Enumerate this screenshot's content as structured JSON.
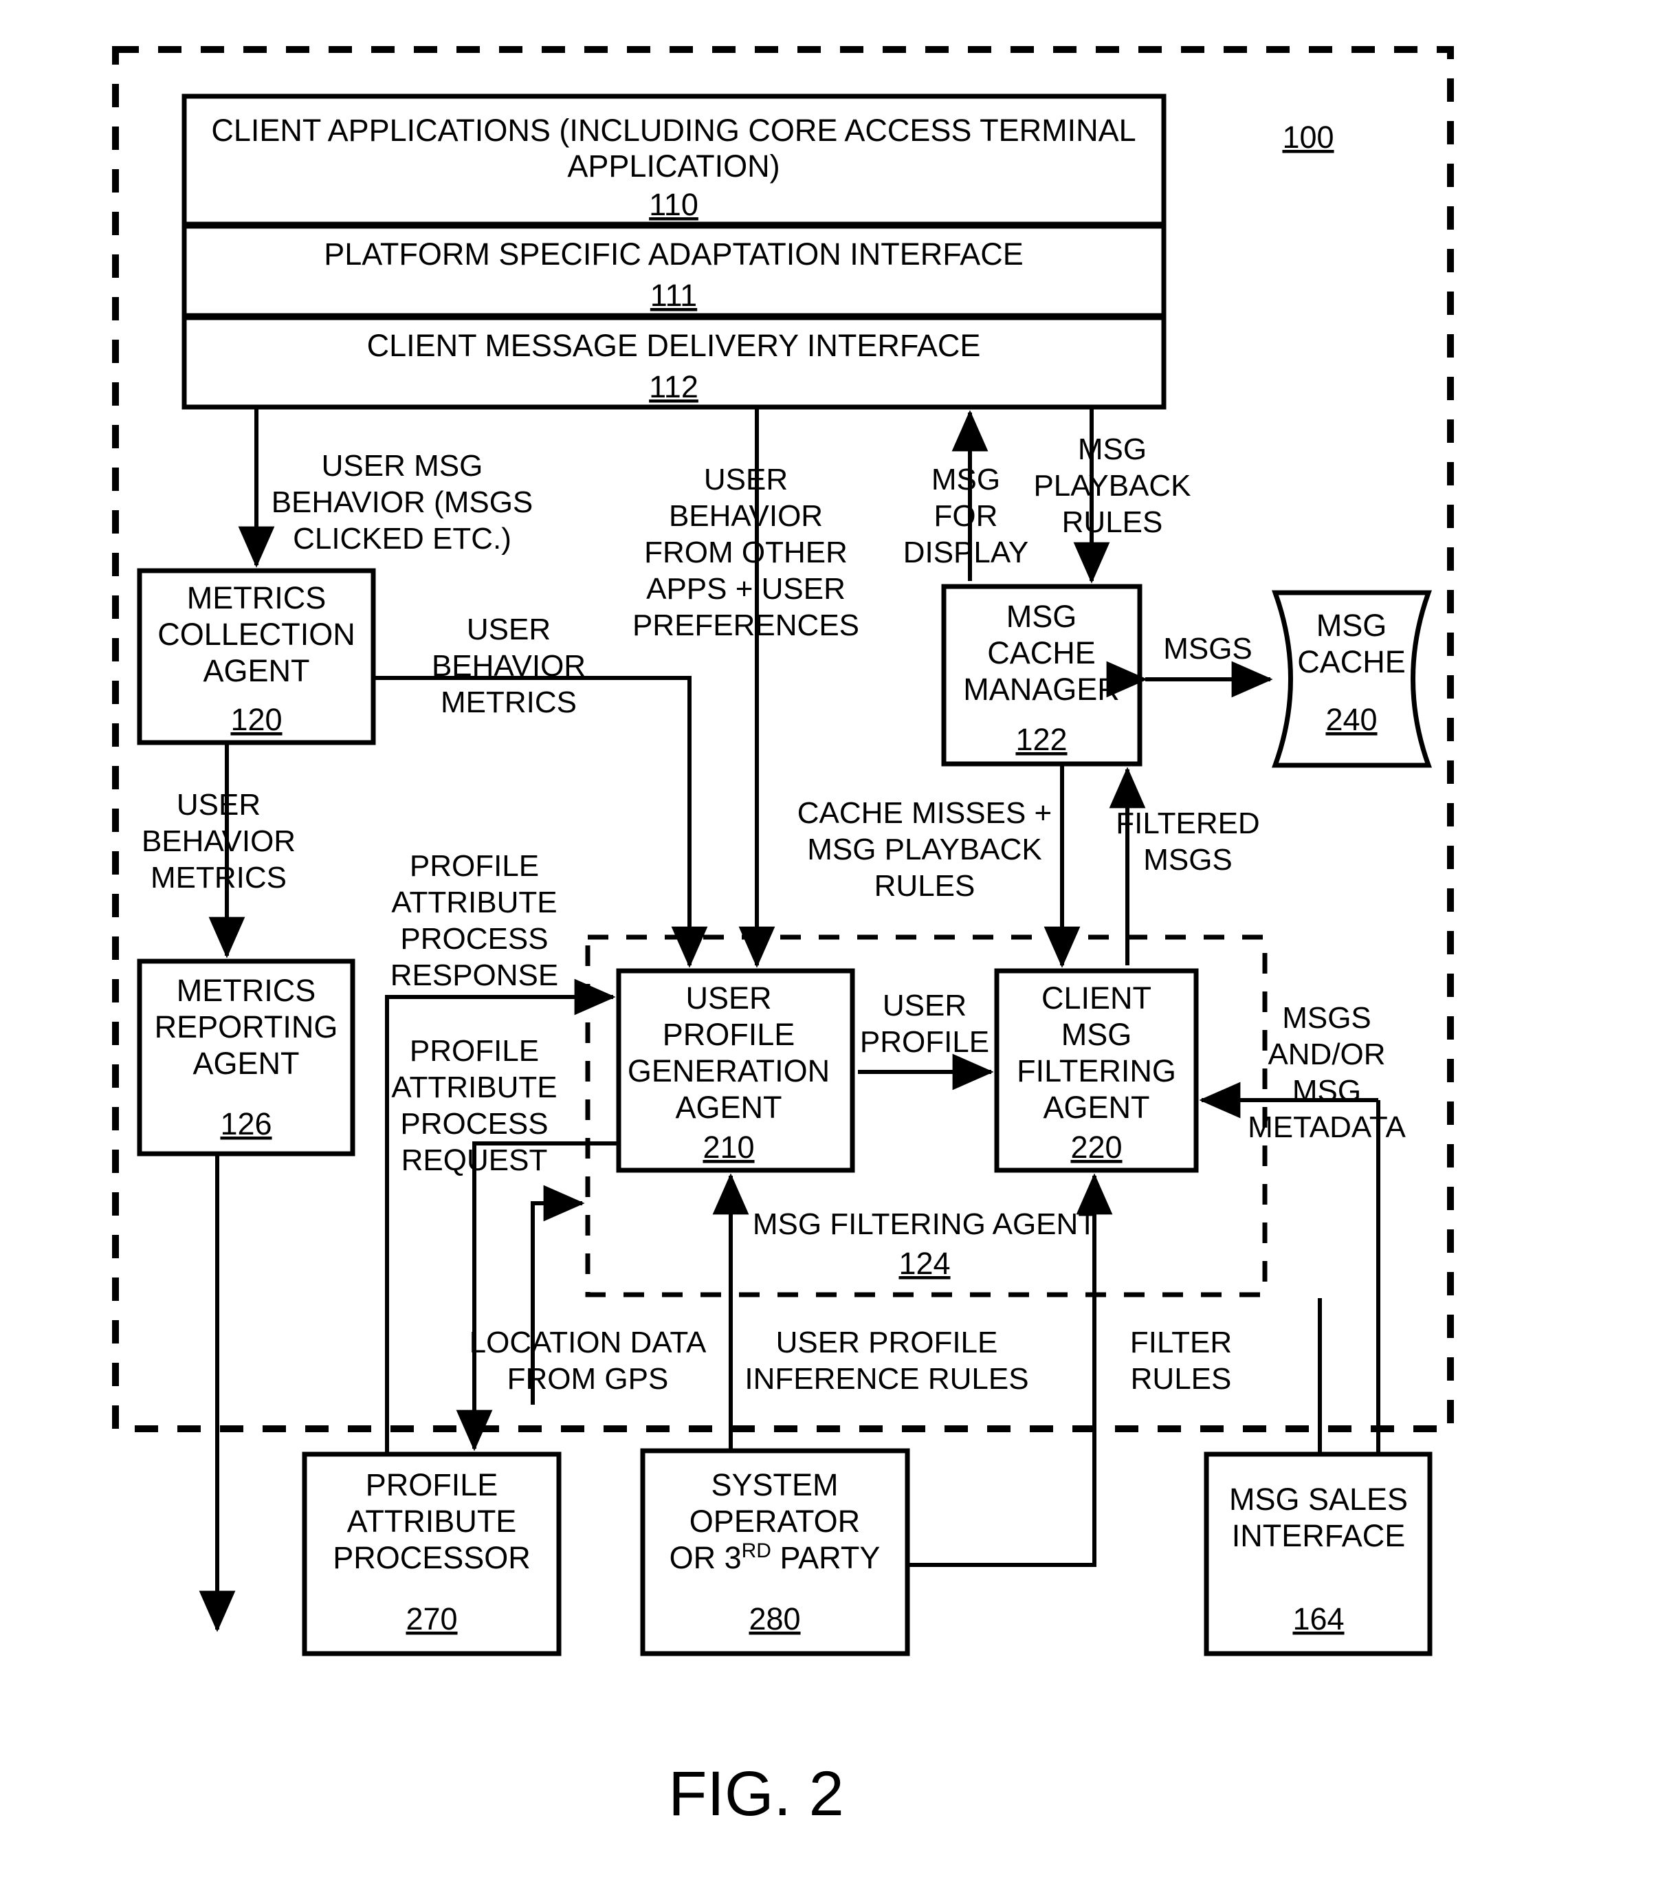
{
  "figure": {
    "caption": "FIG. 2",
    "system_ref": "100"
  },
  "layered_stack": [
    {
      "name": "client-applications",
      "label_line1": "CLIENT APPLICATIONS (INCLUDING CORE ACCESS TERMINAL",
      "label_line2": "APPLICATION)",
      "ref": "110"
    },
    {
      "name": "platform-adaptation-interface",
      "label_line1": "PLATFORM SPECIFIC ADAPTATION INTERFACE",
      "label_line2": "",
      "ref": "111"
    },
    {
      "name": "client-message-delivery-interface",
      "label_line1": "CLIENT MESSAGE DELIVERY INTERFACE",
      "label_line2": "",
      "ref": "112"
    }
  ],
  "boxes": {
    "metrics_collection_agent": {
      "lines": [
        "METRICS",
        "COLLECTION",
        "AGENT"
      ],
      "ref": "120"
    },
    "metrics_reporting_agent": {
      "lines": [
        "METRICS",
        "REPORTING",
        "AGENT"
      ],
      "ref": "126"
    },
    "msg_cache_manager": {
      "lines": [
        "MSG",
        "CACHE",
        "MANAGER"
      ],
      "ref": "122"
    },
    "msg_cache": {
      "lines": [
        "MSG",
        "CACHE"
      ],
      "ref": "240"
    },
    "user_profile_generation_agent": {
      "lines": [
        "USER",
        "PROFILE",
        "GENERATION",
        "AGENT"
      ],
      "ref": "210"
    },
    "client_msg_filtering_agent": {
      "lines": [
        "CLIENT",
        "MSG",
        "FILTERING",
        "AGENT"
      ],
      "ref": "220"
    },
    "profile_attribute_processor": {
      "lines": [
        "PROFILE",
        "ATTRIBUTE",
        "PROCESSOR"
      ],
      "ref": "270"
    },
    "system_operator": {
      "lines": [
        "SYSTEM",
        "OPERATOR",
        "OR 3RD PARTY"
      ],
      "line3_pre": "OR 3",
      "line3_sup": "RD",
      "line3_post": " PARTY",
      "ref": "280"
    },
    "msg_sales_interface": {
      "lines": [
        "MSG SALES",
        "INTERFACE"
      ],
      "ref": "164"
    }
  },
  "group_dashed": {
    "label": "MSG FILTERING AGENT",
    "ref": "124"
  },
  "edge_labels": {
    "user_msg_behavior": [
      "USER MSG",
      "BEHAVIOR (MSGS",
      "CLICKED ETC.)"
    ],
    "user_behavior_other_apps": [
      "USER",
      "BEHAVIOR",
      "FROM OTHER",
      "APPS + USER",
      "PREFERENCES"
    ],
    "msg_for_display": [
      "MSG",
      "FOR",
      "DISPLAY"
    ],
    "msg_playback_rules": [
      "MSG",
      "PLAYBACK",
      "RULES"
    ],
    "user_behavior_metrics_right": [
      "USER",
      "BEHAVIOR",
      "METRICS"
    ],
    "user_behavior_metrics_down": [
      "USER",
      "BEHAVIOR",
      "METRICS"
    ],
    "msgs_cache": [
      "MSGS"
    ],
    "cache_misses": [
      "CACHE MISSES +",
      "MSG PLAYBACK",
      "RULES"
    ],
    "filtered_msgs": [
      "FILTERED",
      "MSGS"
    ],
    "profile_attr_response": [
      "PROFILE",
      "ATTRIBUTE",
      "PROCESS",
      "RESPONSE"
    ],
    "profile_attr_request": [
      "PROFILE",
      "ATTRIBUTE",
      "PROCESS",
      "REQUEST"
    ],
    "user_profile": [
      "USER",
      "PROFILE"
    ],
    "msgs_metadata": [
      "MSGS",
      "AND/OR",
      "MSG",
      "METADATA"
    ],
    "location_data": [
      "LOCATION DATA",
      "FROM GPS"
    ],
    "user_profile_inference": [
      "USER PROFILE",
      "INFERENCE RULES"
    ],
    "filter_rules": [
      "FILTER",
      "RULES"
    ]
  }
}
